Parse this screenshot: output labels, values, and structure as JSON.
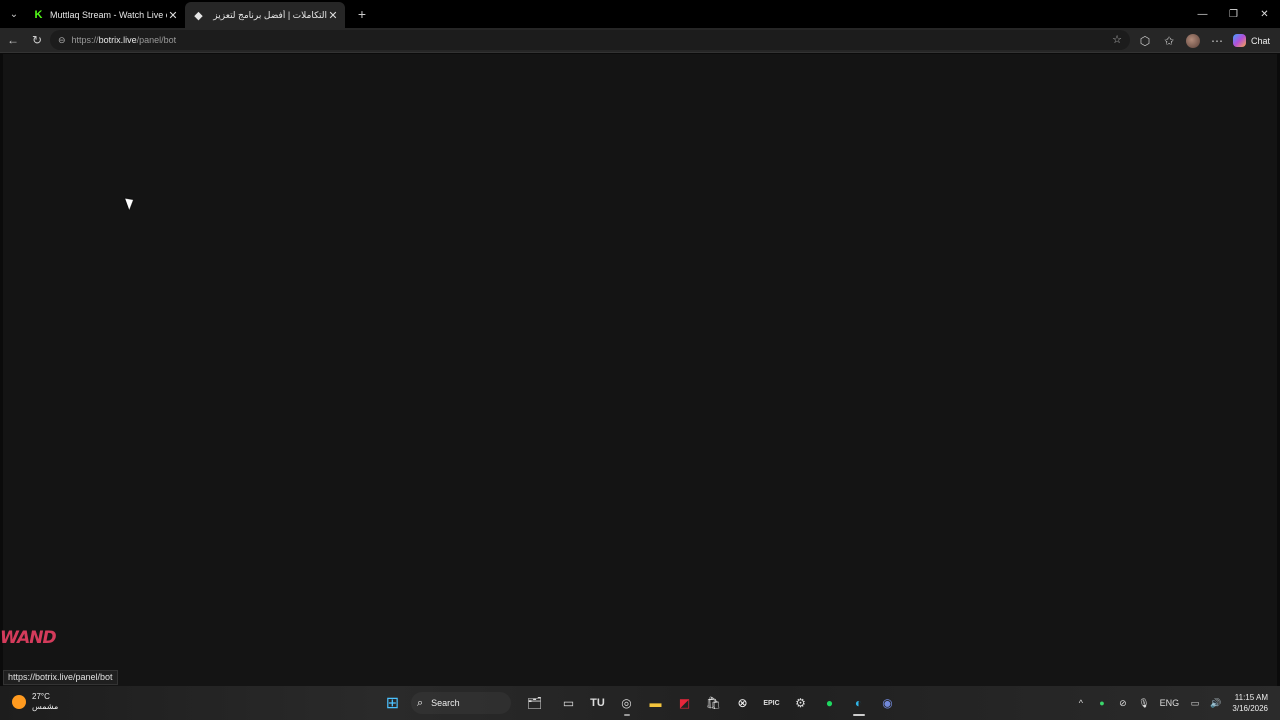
{
  "tabs": [
    {
      "title": "Muttlaq Stream - Watch Live on Ki",
      "favicon": "K",
      "favicon_color": "#53fc18",
      "active": false
    },
    {
      "title": "التكاملات | أفضل برنامج لتعزيز البث",
      "favicon": "◆",
      "favicon_color": "#ffffff",
      "active": true
    }
  ],
  "address": {
    "prefix": "https://",
    "host": "botrix.live",
    "path": "/panel/bot"
  },
  "toolbar": {
    "chat_label": "Chat"
  },
  "page": {
    "logo_text": "WAND",
    "status_url": "https://botrix.live/panel/bot"
  },
  "taskbar": {
    "temperature": "27°C",
    "condition": "مشمس",
    "search_label": "Search",
    "tray_lang": "ENG",
    "time": "11:15 AM",
    "date": "3/16/2026"
  },
  "colors": {
    "background": "#141414",
    "logo": "#d43b5b"
  }
}
